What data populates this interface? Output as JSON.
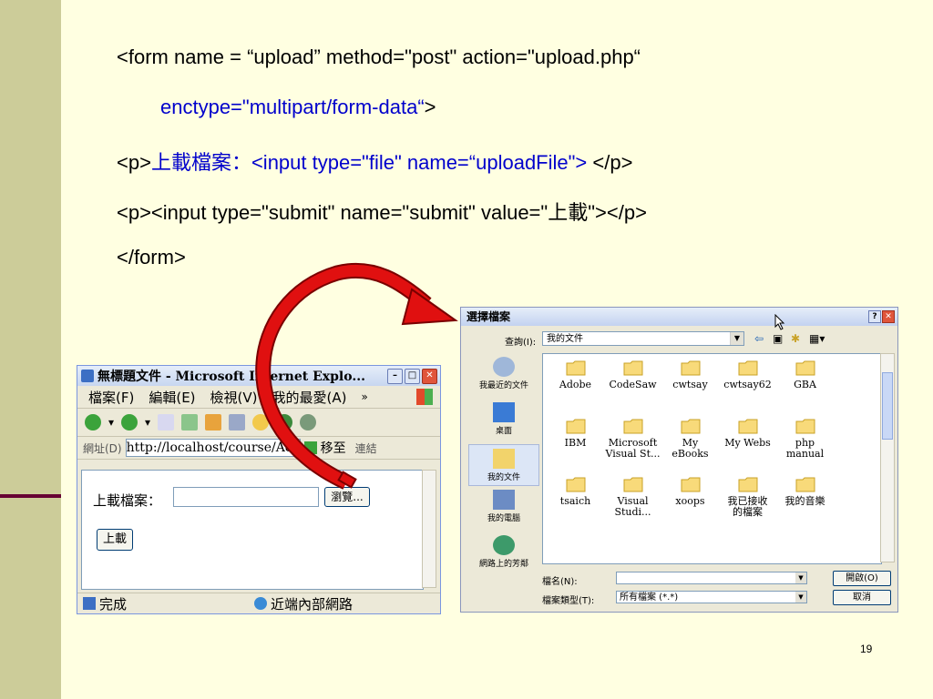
{
  "slide": {
    "code_line1": "<form name = “upload” method=\"post\" action=\"upload.php“",
    "code_line2": "enctype=\"multipart/form-data“",
    "code_line2_end": ">",
    "code_line3_a": "<p>",
    "code_line3_b": "上載檔案：",
    "code_line3_c": "<input type=\"file\" name=“uploadFile\">",
    "code_line3_d": " </p>",
    "code_line4": "<p><input type=\"submit\" name=\"submit\" value=\"上載\"></p>",
    "code_line5": "</form>",
    "page_number": "19"
  },
  "colors": {
    "background": "#FFFFE1",
    "sidebar": "#CCCC99",
    "accent_line": "#660033",
    "code_blue": "#0000CC",
    "arrow_red": "#E01010"
  },
  "ie": {
    "title": "無標題文件 - Microsoft Internet Explo...",
    "menu": [
      "檔案(F)",
      "編輯(E)",
      "檢視(V)",
      "我的最愛(A)"
    ],
    "menu_more": "»",
    "address_label": "網址(D)",
    "address_value": "http://localhost/course/Ac",
    "go_label": "移至",
    "links_label": "連結",
    "form_label": "上載檔案：",
    "browse_label": "瀏覽...",
    "submit_label": "上載",
    "status_done": "完成",
    "status_zone": "近端內部網路"
  },
  "dialog": {
    "title": "選擇檔案",
    "lookin_label": "查詢(I):",
    "lookin_value": "我的文件",
    "places": [
      "我最近的文件",
      "桌面",
      "我的文件",
      "我的電腦",
      "網路上的芳鄰"
    ],
    "files": [
      {
        "line1": "Adobe",
        "line2": ""
      },
      {
        "line1": "CodeSaw",
        "line2": ""
      },
      {
        "line1": "cwtsay",
        "line2": ""
      },
      {
        "line1": "cwtsay62",
        "line2": ""
      },
      {
        "line1": "GBA",
        "line2": ""
      },
      {
        "line1": "IBM",
        "line2": ""
      },
      {
        "line1": "Microsoft",
        "line2": "Visual St..."
      },
      {
        "line1": "My",
        "line2": "eBooks"
      },
      {
        "line1": "My Webs",
        "line2": ""
      },
      {
        "line1": "php",
        "line2": "manual"
      },
      {
        "line1": "tsaich",
        "line2": ""
      },
      {
        "line1": "Visual",
        "line2": "Studi..."
      },
      {
        "line1": "xoops",
        "line2": ""
      },
      {
        "line1": "我已接收",
        "line2": "的檔案"
      },
      {
        "line1": "我的音樂",
        "line2": ""
      }
    ],
    "filename_label": "檔名(N):",
    "filename_value": "",
    "filetype_label": "檔案類型(T):",
    "filetype_value": "所有檔案 (*.*)",
    "open_button": "開啟(O)",
    "cancel_button": "取消"
  }
}
